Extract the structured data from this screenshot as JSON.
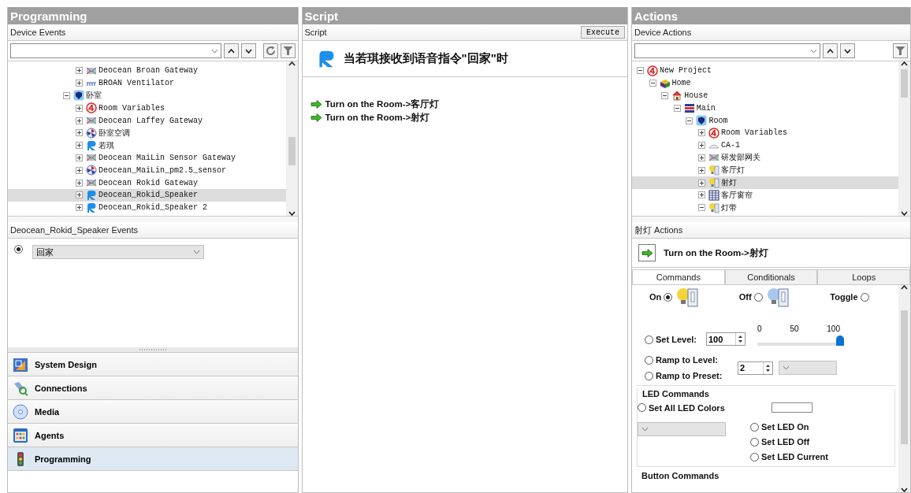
{
  "programming": {
    "title": "Programming",
    "subheader": "Device Events",
    "tree": [
      {
        "children": [
          {
            "label": "Deocean Broan Gateway",
            "kind": "gateway",
            "expanded": false,
            "selected": false
          },
          {
            "label": "BROAN Ventilator",
            "kind": "ventilator",
            "expanded": false,
            "selected": false
          }
        ]
      },
      {
        "label": "卧室",
        "kind": "room",
        "expanded": true,
        "selected": false,
        "children": [
          {
            "label": "Room Variables",
            "kind": "variables",
            "expanded": false,
            "selected": false
          },
          {
            "label": "Deocean Laffey Gateway",
            "kind": "gateway",
            "expanded": false,
            "selected": false
          },
          {
            "label": "卧室空调",
            "kind": "aircon",
            "expanded": false,
            "selected": false
          },
          {
            "label": "若琪",
            "kind": "rokid",
            "expanded": false,
            "selected": false
          },
          {
            "label": "Deocean MaiLin Sensor Gateway",
            "kind": "gateway",
            "expanded": false,
            "selected": false
          },
          {
            "label": "Deocean_MaiLin_pm2.5_sensor",
            "kind": "aircon",
            "expanded": false,
            "selected": false
          },
          {
            "label": "Deocean Rokid Gateway",
            "kind": "gateway",
            "expanded": false,
            "selected": false
          },
          {
            "label": "Deocean_Rokid_Speaker",
            "kind": "rokid",
            "expanded": false,
            "selected": true
          },
          {
            "label": "Deocean_Rokid_Speaker 2",
            "kind": "rokid",
            "expanded": false,
            "selected": false
          }
        ]
      }
    ],
    "events_title": "Deocean_Rokid_Speaker Events",
    "events": [
      {
        "selected": true,
        "value": "回家"
      }
    ],
    "nav": [
      {
        "label": "System Design",
        "kind": "design",
        "selected": false
      },
      {
        "label": "Connections",
        "kind": "connections",
        "selected": false
      },
      {
        "label": "Media",
        "kind": "media",
        "selected": false
      },
      {
        "label": "Agents",
        "kind": "agents",
        "selected": false
      },
      {
        "label": "Programming",
        "kind": "programming",
        "selected": true
      }
    ]
  },
  "script": {
    "title": "Script",
    "subheader": "Script",
    "execute": "Execute",
    "trigger": "当若琪接收到语音指令\"回家\"时",
    "actions": [
      "Turn on the Room->客厅灯",
      "Turn on the Room->射灯"
    ]
  },
  "actions": {
    "title": "Actions",
    "subheader": "Device Actions",
    "tree": [
      {
        "label": "New Project",
        "kind": "project",
        "expanded": true,
        "selected": false,
        "children": [
          {
            "label": "Home",
            "kind": "home",
            "expanded": true,
            "selected": false,
            "children": [
              {
                "label": "House",
                "kind": "house",
                "expanded": true,
                "selected": false,
                "children": [
                  {
                    "label": "Main",
                    "kind": "floor",
                    "expanded": true,
                    "selected": false,
                    "children": [
                      {
                        "label": "Room",
                        "kind": "room",
                        "expanded": true,
                        "selected": false,
                        "children": [
                          {
                            "label": "Room Variables",
                            "kind": "variables",
                            "expanded": false,
                            "selected": false
                          },
                          {
                            "label": "CA-1",
                            "kind": "sensor",
                            "expanded": false,
                            "selected": false
                          },
                          {
                            "label": "研发部网关",
                            "kind": "gateway",
                            "expanded": false,
                            "selected": false
                          },
                          {
                            "label": "客厅灯",
                            "kind": "light",
                            "expanded": false,
                            "selected": false
                          },
                          {
                            "label": "射灯",
                            "kind": "light",
                            "expanded": false,
                            "selected": true
                          },
                          {
                            "label": "客厅窗帘",
                            "kind": "blinds",
                            "expanded": false,
                            "selected": false
                          },
                          {
                            "label": "灯带",
                            "kind": "light",
                            "expanded": true,
                            "selected": false
                          }
                        ]
                      }
                    ]
                  }
                ]
              }
            ]
          }
        ]
      }
    ],
    "selected_title": "射灯 Actions",
    "selected_action": "Turn on the Room->射灯",
    "tabs": [
      {
        "label": "Commands",
        "selected": true
      },
      {
        "label": "Conditionals",
        "selected": false
      },
      {
        "label": "Loops",
        "selected": false
      }
    ],
    "power": [
      {
        "label": "On",
        "kind": "on",
        "selected": true
      },
      {
        "label": "Off",
        "kind": "off",
        "selected": false
      },
      {
        "label": "Toggle",
        "kind": "toggle",
        "selected": false
      }
    ],
    "set_level": {
      "label": "Set Level:",
      "selected": false,
      "value": "100",
      "level": 1,
      "ticks": [
        "0",
        "50",
        "100"
      ]
    },
    "ramp": [
      {
        "label": "Ramp to Level:",
        "selected": false
      },
      {
        "label": "Ramp to Preset:",
        "selected": false
      }
    ],
    "ramp_value": "2",
    "led": {
      "title": "LED Commands",
      "set_all": {
        "label": "Set All LED Colors",
        "selected": false
      },
      "options": [
        {
          "label": "Set LED On",
          "selected": false
        },
        {
          "label": "Set LED Off",
          "selected": false
        },
        {
          "label": "Set LED Current",
          "selected": false
        }
      ]
    },
    "button_commands": "Button Commands"
  }
}
